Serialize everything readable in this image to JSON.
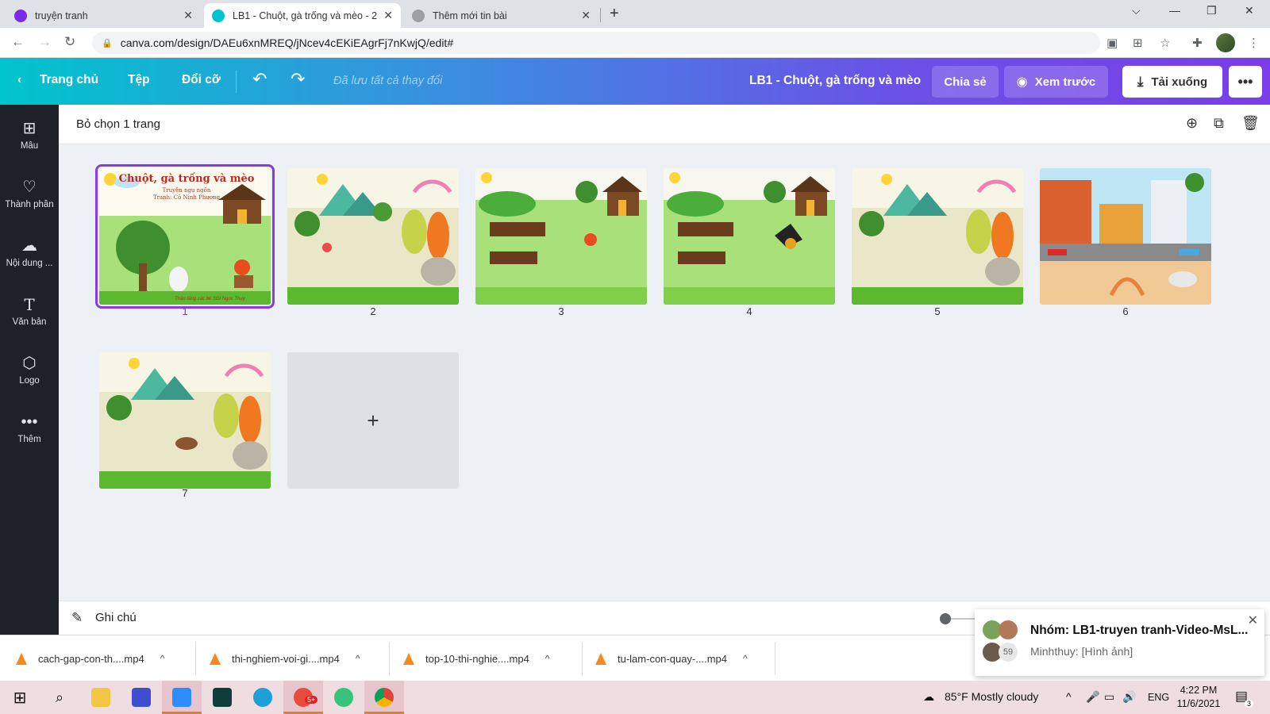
{
  "browser": {
    "tabs": [
      {
        "title": "truyện tranh",
        "active": false,
        "favicon_color": "#7d2ae8"
      },
      {
        "title": "LB1 - Chuột, gà trống và mèo - 2",
        "active": true,
        "favicon_color": "#00c4cc"
      },
      {
        "title": "Thêm mới tin bài",
        "active": false,
        "favicon_color": "#5f6368"
      }
    ],
    "url": "canva.com/design/DAEu6xnMREQ/jNcev4cEKiEAgrFj7nKwjQ/edit#"
  },
  "header": {
    "home": "Trang chủ",
    "file": "Tệp",
    "resize": "Đổi cỡ",
    "saved_status": "Đã lưu tất cả thay đổi",
    "doc_title": "LB1 - Chuột, gà trống và mèo",
    "share": "Chia sẻ",
    "preview": "Xem trước",
    "download": "Tải xuống"
  },
  "sidebar": {
    "items": [
      {
        "label": "Mẫu",
        "icon": "template-icon"
      },
      {
        "label": "Thành phần",
        "icon": "elements-icon"
      },
      {
        "label": "Nội dung ...",
        "icon": "upload-icon"
      },
      {
        "label": "Văn bản",
        "icon": "text-icon"
      },
      {
        "label": "Logo",
        "icon": "logo-icon"
      },
      {
        "label": "Thêm",
        "icon": "more-icon"
      }
    ]
  },
  "page_toolbar": {
    "deselect": "Bỏ chọn 1 trang"
  },
  "pages": [
    {
      "number": "1",
      "selected": true,
      "scene": "cover",
      "title": "Chuột, gà trống và mèo",
      "subtitle": "Truyện ngụ ngôn",
      "author": "Tranh: Cô Ninh Phương",
      "footer": "Thân tặng các bé SĐI Ngọc Thụy"
    },
    {
      "number": "2",
      "selected": false,
      "scene": "meadow"
    },
    {
      "number": "3",
      "selected": false,
      "scene": "farm"
    },
    {
      "number": "4",
      "selected": false,
      "scene": "farm"
    },
    {
      "number": "5",
      "selected": false,
      "scene": "meadow"
    },
    {
      "number": "6",
      "selected": false,
      "scene": "city"
    },
    {
      "number": "7",
      "selected": false,
      "scene": "meadow"
    }
  ],
  "notes": {
    "label": "Ghi chú"
  },
  "downloads": [
    {
      "name": "cach-gap-con-th....mp4"
    },
    {
      "name": "thi-nghiem-voi-gi....mp4"
    },
    {
      "name": "top-10-thi-nghie....mp4"
    },
    {
      "name": "tu-lam-con-quay-....mp4"
    }
  ],
  "notification": {
    "title": "Nhóm: LB1-truyen tranh-Video-MsL...",
    "message": "Minhthuy: [Hình ảnh]",
    "count": "59"
  },
  "taskbar": {
    "weather": "85°F  Mostly cloudy",
    "lang": "ENG",
    "time": "4:22 PM",
    "date": "11/6/2021",
    "notif_count": "3",
    "zalo_badge": "5+"
  },
  "colors": {
    "canva_teal": "#00c4cc",
    "canva_purple": "#7d3be0",
    "selection": "#8b3ddb"
  }
}
